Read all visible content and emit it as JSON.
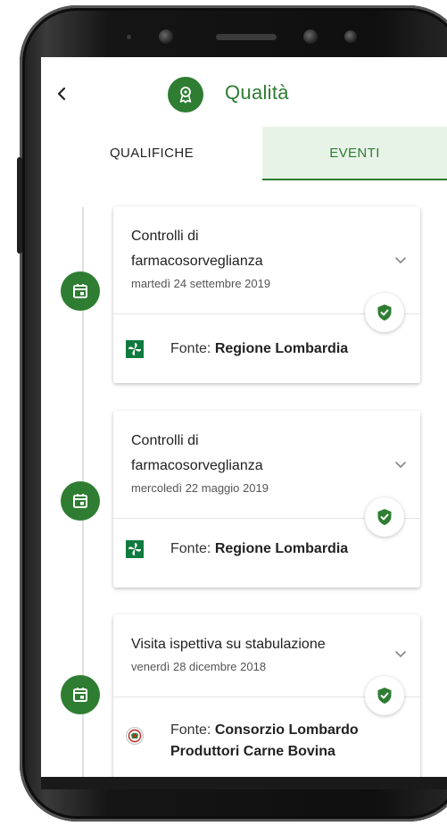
{
  "header": {
    "back_label": "‹",
    "title": "Qualità",
    "logo_icon": "award-ribbon-icon"
  },
  "tabs": [
    {
      "label": "QUALIFICHE",
      "active": false
    },
    {
      "label": "EVENTI",
      "active": true
    }
  ],
  "colors": {
    "accent": "#2e7d32",
    "active_tab_bg": "#e8f3e8"
  },
  "source_prefix": "Fonte:",
  "events": [
    {
      "title_line1": "Controlli di",
      "title_line2": "farmacosorveglianza",
      "date": "martedì 24 settembre 2019",
      "source_line1": "Regione Lombardia",
      "source_line2": "",
      "source_logo": "regione-lombardia-logo",
      "verified": true
    },
    {
      "title_line1": "Controlli di",
      "title_line2": "farmacosorveglianza",
      "date": "mercoledì 22 maggio 2019",
      "source_line1": "Regione Lombardia",
      "source_line2": "",
      "source_logo": "regione-lombardia-logo",
      "verified": true
    },
    {
      "title_line1": "Visita ispettiva su stabulazione",
      "title_line2": "",
      "date": "venerdì 28 dicembre 2018",
      "source_line1": "Consorzio Lombardo",
      "source_line2": "Produttori Carne Bovina",
      "source_logo": "consorzio-lombardo-logo",
      "verified": true
    }
  ]
}
